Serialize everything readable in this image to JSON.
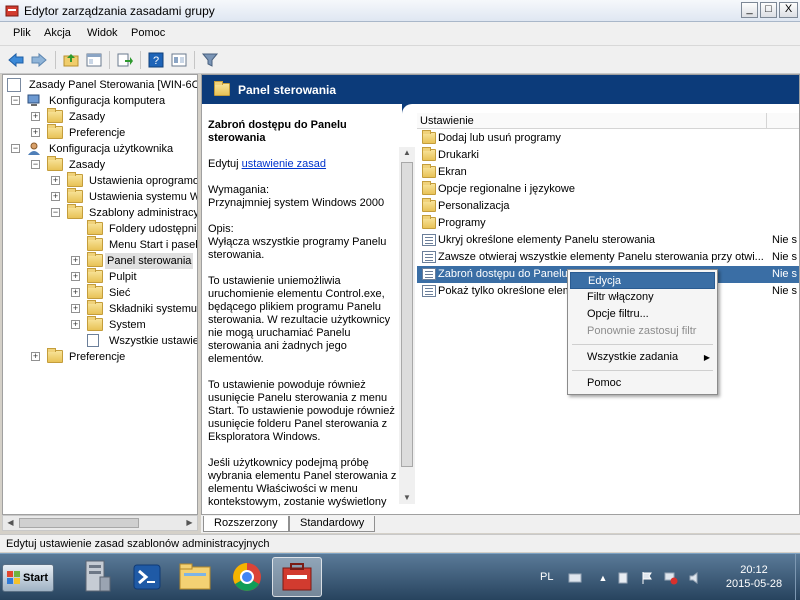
{
  "window": {
    "title": "Edytor zarządzania zasadami grupy",
    "min_label": "_",
    "max_label": "□",
    "close_label": "X"
  },
  "menu": [
    "Plik",
    "Akcja",
    "Widok",
    "Pomoc"
  ],
  "tree": {
    "root": "Zasady Panel Sterowania [WIN-6C",
    "items": [
      {
        "label": "Konfiguracja komputera",
        "expander": "−"
      },
      {
        "label": "Zasady",
        "expander": "+"
      },
      {
        "label": "Preferencje",
        "expander": "+"
      },
      {
        "label": "Konfiguracja użytkownika",
        "expander": "−"
      },
      {
        "label": "Zasady",
        "expander": "−"
      },
      {
        "label": "Ustawienia oprogramow",
        "expander": "+"
      },
      {
        "label": "Ustawienia systemu Wi",
        "expander": "+"
      },
      {
        "label": "Szablony administracyjn",
        "expander": "−"
      },
      {
        "label": "Foldery udostępnio",
        "expander": ""
      },
      {
        "label": "Menu Start i pasek",
        "expander": ""
      },
      {
        "label": "Panel sterowania",
        "expander": "+"
      },
      {
        "label": "Pulpit",
        "expander": "+"
      },
      {
        "label": "Sieć",
        "expander": "+"
      },
      {
        "label": "Składniki systemu W",
        "expander": "+"
      },
      {
        "label": "System",
        "expander": "+"
      },
      {
        "label": "Wszystkie ustawien",
        "expander": ""
      },
      {
        "label": "Preferencje",
        "expander": "+"
      }
    ]
  },
  "right": {
    "header": "Panel sterowania",
    "desc": {
      "title": "Zabroń dostępu do Panelu sterowania",
      "edit_prefix": "Edytuj",
      "edit_link": "ustawienie zasad",
      "req_label": "Wymagania:",
      "req_value": "Przynajmniej system Windows 2000",
      "opis_label": "Opis:",
      "p1": "Wyłącza wszystkie programy Panelu sterowania.",
      "p2": "To ustawienie uniemożliwia uruchomienie elementu Control.exe, będącego plikiem programu Panelu sterowania. W rezultacie użytkownicy nie mogą uruchamiać Panelu sterowania ani żadnych jego elementów.",
      "p3": "To ustawienie powoduje również usunięcie Panelu sterowania z menu Start. To ustawienie powoduje również usunięcie folderu Panel sterowania z Eksploratora Windows.",
      "p4": "Jeśli użytkownicy podejmą próbę wybrania elementu Panel sterowania z elementu Właściwości w menu kontekstowym, zostanie wyświetlony"
    },
    "list_header": "Ustawienie",
    "rows": [
      {
        "label": "Dodaj lub usuń programy",
        "state": "",
        "kind": "folder"
      },
      {
        "label": "Drukarki",
        "state": "",
        "kind": "folder"
      },
      {
        "label": "Ekran",
        "state": "",
        "kind": "folder"
      },
      {
        "label": "Opcje regionalne i językowe",
        "state": "",
        "kind": "folder"
      },
      {
        "label": "Personalizacja",
        "state": "",
        "kind": "folder"
      },
      {
        "label": "Programy",
        "state": "",
        "kind": "folder"
      },
      {
        "label": "Ukryj określone elementy Panelu sterowania",
        "state": "Nie s",
        "kind": "policy"
      },
      {
        "label": "Zawsze otwieraj wszystkie elementy Panelu sterowania przy otwi...",
        "state": "Nie s",
        "kind": "policy"
      },
      {
        "label": "Zabroń dostępu do Panelu s",
        "state": "Nie s",
        "kind": "policy"
      },
      {
        "label": "Pokaż tylko określone eleme",
        "state": "Nie s",
        "kind": "policy"
      }
    ]
  },
  "context_menu": {
    "edit": "Edycja",
    "filter_on": "Filtr włączony",
    "filter_opts": "Opcje filtru...",
    "reapply": "Ponownie zastosuj filtr",
    "all_tasks": "Wszystkie zadania",
    "help": "Pomoc"
  },
  "tabs": {
    "extended": "Rozszerzony",
    "standard": "Standardowy"
  },
  "status": "Edytuj ustawienie zasad szablonów administracyjnych",
  "taskbar": {
    "start": "Start",
    "lang": "PL",
    "time": "20:12",
    "date": "2015-05-28"
  },
  "colors": {
    "header_blue": "#0c3b7a",
    "selection": "#3a6ea5"
  }
}
